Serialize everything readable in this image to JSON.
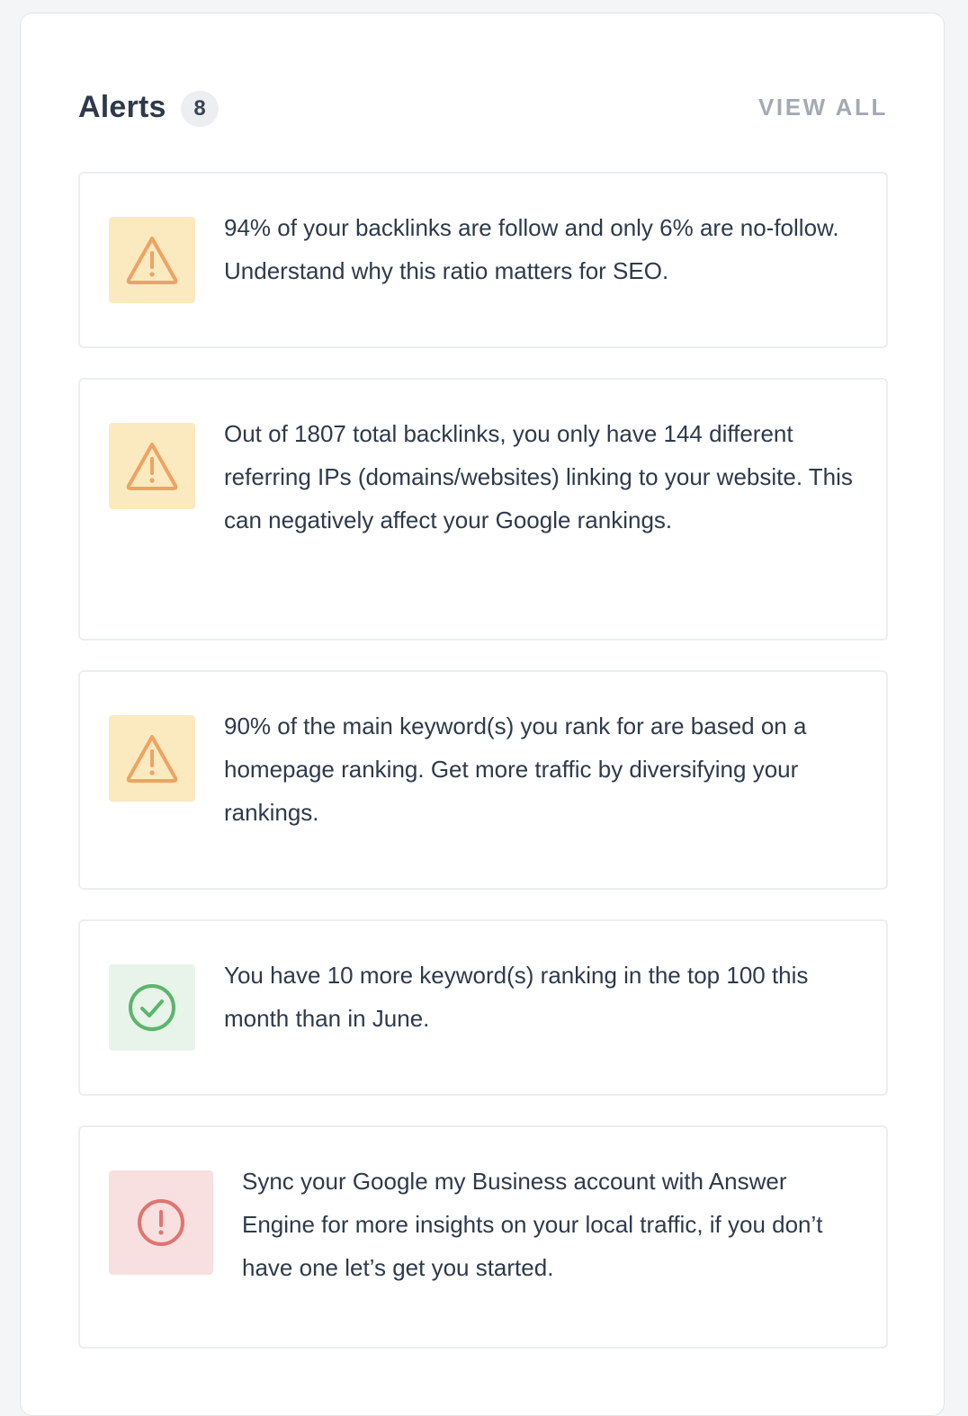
{
  "header": {
    "title": "Alerts",
    "count": "8",
    "view_all_label": "VIEW ALL"
  },
  "colors": {
    "warning_bg": "#fbeac0",
    "warning_icon": "#f0a262",
    "success_bg": "#e8f4ea",
    "success_icon": "#5cb56b",
    "error_bg": "#f8e0e0",
    "error_icon": "#e17470"
  },
  "alerts": [
    {
      "type": "warning",
      "icon": "warning-triangle-icon",
      "text": "94% of your backlinks are follow and only 6% are no-follow. Understand why this ratio matters for SEO."
    },
    {
      "type": "warning",
      "icon": "warning-triangle-icon",
      "text": "Out of 1807 total backlinks, you only have 144 different referring IPs (domains/websites) linking to your website. This can negatively affect your Google rankings."
    },
    {
      "type": "warning",
      "icon": "warning-triangle-icon",
      "text": "90% of the main keyword(s) you rank for are based on a homepage ranking. Get more traffic by diversifying your rankings."
    },
    {
      "type": "success",
      "icon": "check-circle-icon",
      "text": "You have 10 more keyword(s) ranking in the top 100 this month than in June."
    },
    {
      "type": "error",
      "icon": "exclamation-circle-icon",
      "text": "Sync your Google my Business account with Answer Engine for more insights on your local traffic, if you don’t have one let’s get you started."
    }
  ]
}
